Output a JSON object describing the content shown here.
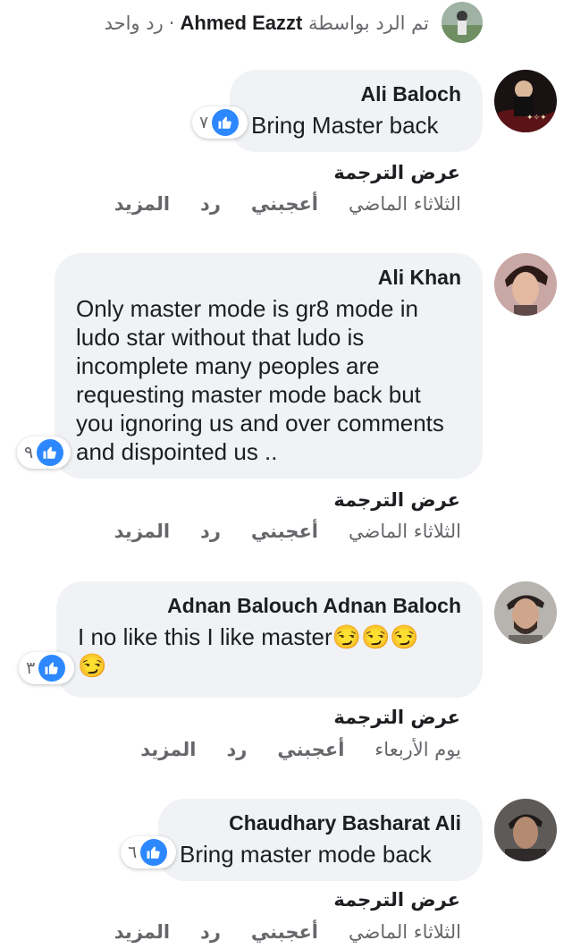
{
  "top_reply": {
    "replied_by_prefix": "تم الرد بواسطة",
    "name": "Ahmed Eazzt",
    "separator": "·",
    "reply_count": "رد واحد"
  },
  "comments": [
    {
      "author": "Ali Baloch",
      "text": "Bring Master back",
      "reaction_count": "٧",
      "translate": "عرض الترجمة",
      "time": "الثلاثاء الماضي",
      "like": "أعجبني",
      "reply": "رد",
      "more": "المزيد"
    },
    {
      "author": "Ali Khan",
      "text": "Only master mode is gr8 mode in ludo star without that ludo is incomplete many peoples are requesting master mode back but you ignoring us and over comments and dispointed us ..",
      "reaction_count": "٩",
      "translate": "عرض الترجمة",
      "time": "الثلاثاء الماضي",
      "like": "أعجبني",
      "reply": "رد",
      "more": "المزيد"
    },
    {
      "author": "Adnan Balouch Adnan Baloch",
      "text": "I no like this I like master😏😏😏 😏",
      "reaction_count": "٣",
      "translate": "عرض الترجمة",
      "time": "يوم الأربعاء",
      "like": "أعجبني",
      "reply": "رد",
      "more": "المزيد"
    },
    {
      "author": "Chaudhary Basharat Ali",
      "text": "Bring master mode back",
      "reaction_count": "٦",
      "translate": "عرض الترجمة",
      "time": "الثلاثاء الماضي",
      "like": "أعجبني",
      "reply": "رد",
      "more": "المزيد"
    }
  ],
  "colors": {
    "bubble": "#f0f2f5",
    "like_blue": "#2d88ff",
    "meta_gray": "#65676b"
  }
}
